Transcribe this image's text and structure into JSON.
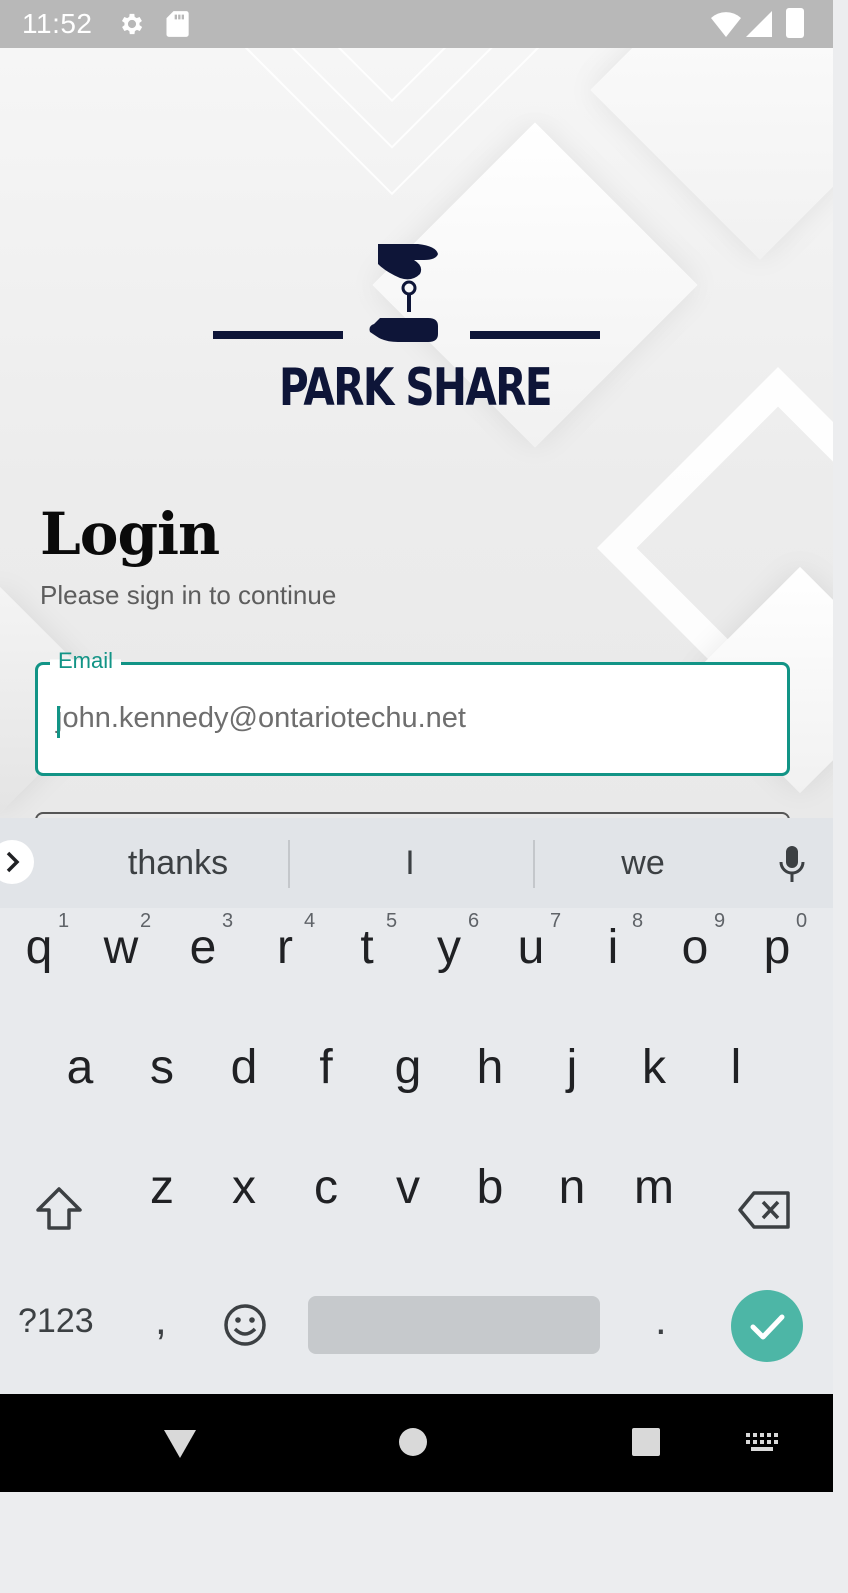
{
  "status_bar": {
    "time": "11:52",
    "icons": [
      "gear-icon",
      "sd-card-icon",
      "wifi-icon",
      "signal-icon",
      "battery-icon"
    ]
  },
  "logo": {
    "text": "PARK SHARE",
    "icon": "key-handover-icon"
  },
  "login": {
    "title": "Login",
    "subtitle": "Please sign in to continue"
  },
  "email": {
    "label": "Email",
    "value": "john.kennedy@ontariotechu.net"
  },
  "keyboard": {
    "suggestions": [
      "thanks",
      "I",
      "we"
    ],
    "row1": [
      {
        "k": "q",
        "h": "1"
      },
      {
        "k": "w",
        "h": "2"
      },
      {
        "k": "e",
        "h": "3"
      },
      {
        "k": "r",
        "h": "4"
      },
      {
        "k": "t",
        "h": "5"
      },
      {
        "k": "y",
        "h": "6"
      },
      {
        "k": "u",
        "h": "7"
      },
      {
        "k": "i",
        "h": "8"
      },
      {
        "k": "o",
        "h": "9"
      },
      {
        "k": "p",
        "h": "0"
      }
    ],
    "row2": [
      "a",
      "s",
      "d",
      "f",
      "g",
      "h",
      "j",
      "k",
      "l"
    ],
    "row3": [
      "z",
      "x",
      "c",
      "v",
      "b",
      "n",
      "m"
    ],
    "symbols_label": "?123",
    "comma": ",",
    "period": "."
  },
  "colors": {
    "accent": "#129486",
    "brand": "#0e1538",
    "enter": "#4db6a6"
  }
}
